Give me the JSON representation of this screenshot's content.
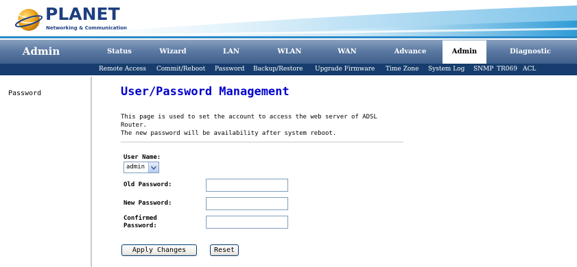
{
  "brand": {
    "name": "PLANET",
    "tagline": "Networking & Communication"
  },
  "colors": {
    "nav_bg": "#5c7aa3",
    "subnav_bg": "#163d6d",
    "title": "#0000cc",
    "header_swoosh": "#2e9bd6"
  },
  "nav": {
    "section_title": "Admin",
    "tabs": [
      {
        "label": "Status"
      },
      {
        "label": "Wizard"
      },
      {
        "label": "LAN"
      },
      {
        "label": "WLAN"
      },
      {
        "label": "WAN"
      },
      {
        "label": "Advance"
      },
      {
        "label": "Admin"
      },
      {
        "label": "Diagnostic"
      }
    ],
    "active_tab": "Admin"
  },
  "subnav": {
    "links": [
      {
        "label": "Remote Access"
      },
      {
        "label": "Commit/Reboot"
      },
      {
        "label": "Password"
      },
      {
        "label": "Backup/Restore"
      },
      {
        "label": "Upgrade Firmware"
      },
      {
        "label": "Time Zone"
      },
      {
        "label": "System Log"
      },
      {
        "label": "SNMP"
      },
      {
        "label": "TR069"
      },
      {
        "label": "ACL"
      }
    ]
  },
  "sidebar": {
    "items": [
      {
        "label": "Password"
      }
    ]
  },
  "main": {
    "title": "User/Password Management",
    "description_line1": "This page is used to set the account to access the web server of ADSL Router.",
    "description_line2": "The new password will be availability after system reboot.",
    "form": {
      "username_label": "User Name:",
      "username_value": "admin",
      "old_password_label": "Old Password:",
      "new_password_label": "New Password:",
      "confirm_password_label": "Confirmed Password:",
      "old_password_value": "",
      "new_password_value": "",
      "confirm_password_value": ""
    },
    "buttons": {
      "apply": "Apply Changes",
      "reset": "Reset"
    }
  }
}
